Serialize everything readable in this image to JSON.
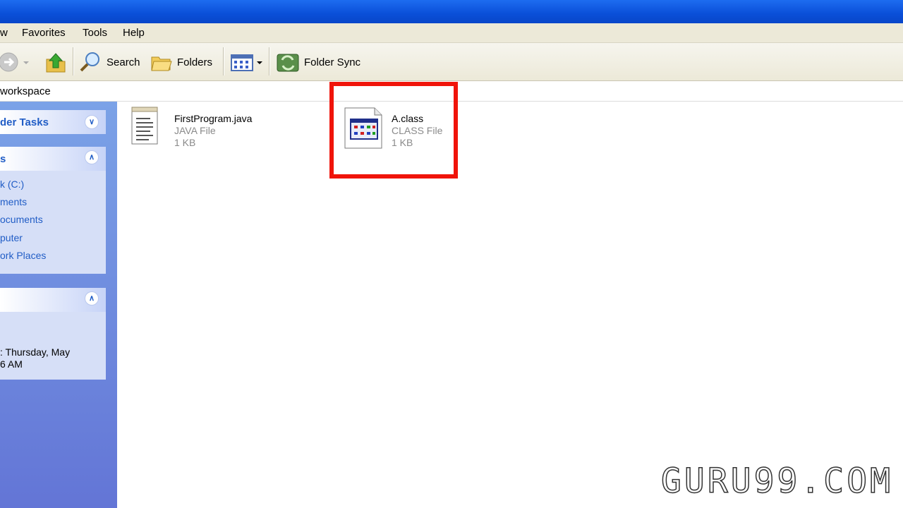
{
  "menubar": {
    "items": [
      "w",
      "Favorites",
      "Tools",
      "Help"
    ]
  },
  "toolbar": {
    "search_label": "Search",
    "folders_label": "Folders",
    "folder_sync_label": "Folder Sync"
  },
  "address": {
    "path": "workspace"
  },
  "sidebar": {
    "file_folder_tasks_title": "der Tasks",
    "other_places_title": "s",
    "other_places_links": [
      "k (C:)",
      "ments",
      "ocuments",
      "puter",
      "ork Places"
    ],
    "details_line1": ": Thursday, May",
    "details_line2": "6 AM"
  },
  "files": [
    {
      "name": "FirstProgram.java",
      "type": "JAVA File",
      "size": "1 KB",
      "icon": "text-document-icon"
    },
    {
      "name": "A.class",
      "type": "CLASS File",
      "size": "1 KB",
      "icon": "class-file-icon"
    }
  ],
  "watermark": "GURU99.COM",
  "colors": {
    "highlight": "#f0140a",
    "sidebar_link": "#215dc6",
    "titlebar": "#0a4fd8"
  }
}
